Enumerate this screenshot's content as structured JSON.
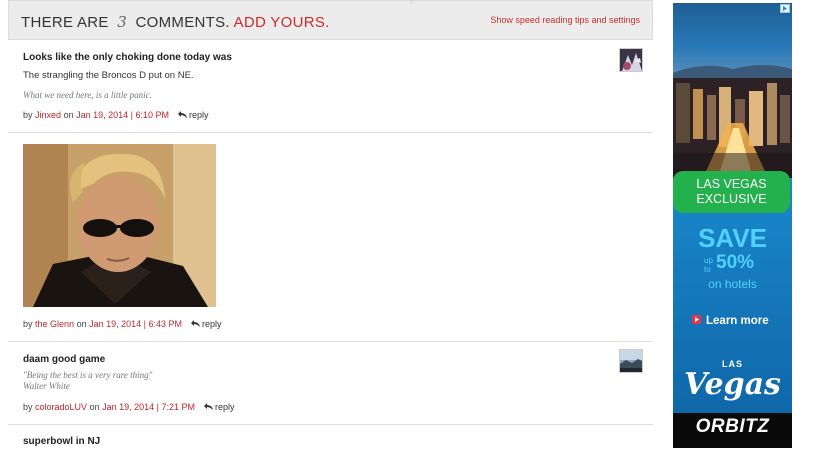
{
  "header": {
    "prefix": "THERE ARE",
    "count": "3",
    "suffix": "COMMENTS.",
    "add_link": "ADD YOURS.",
    "tips_link": "Show speed reading tips and settings"
  },
  "comments": [
    {
      "title": "Looks like the only choking done today was",
      "body": "The strangling the Broncos D put on NE.",
      "signature": "What we need here, is a little panic.",
      "by": "by",
      "author": "Jinxed",
      "on": "on",
      "date": "Jan 19, 2014 | 6:10 PM",
      "reply": "reply"
    },
    {
      "by": "by",
      "author": "the Glenn",
      "on": "on",
      "date": "Jan 19, 2014 | 6:43 PM",
      "reply": "reply"
    },
    {
      "title": "daam good game",
      "signature_line1": "\"Being the best is a very rare thing\"",
      "signature_line2": "Walter White",
      "by": "by",
      "author": "coloradoLUV",
      "on": "on",
      "date": "Jan 19, 2014 | 7:21 PM",
      "reply": "reply"
    },
    {
      "title": "superbowl in NJ"
    }
  ],
  "ad": {
    "badge_line1": "LAS VEGAS",
    "badge_line2": "EXCLUSIVE",
    "save": "SAVE",
    "up": "up",
    "to": "to",
    "percent": "50%",
    "on_hotels": "on hotels",
    "learn_more": "Learn more",
    "logo_small": "LAS",
    "logo_script": "Vegas",
    "brand": "ORBITZ",
    "colors": {
      "bg": "#1475b6",
      "green": "#22b14c",
      "cyan": "#4fd2ff"
    }
  }
}
